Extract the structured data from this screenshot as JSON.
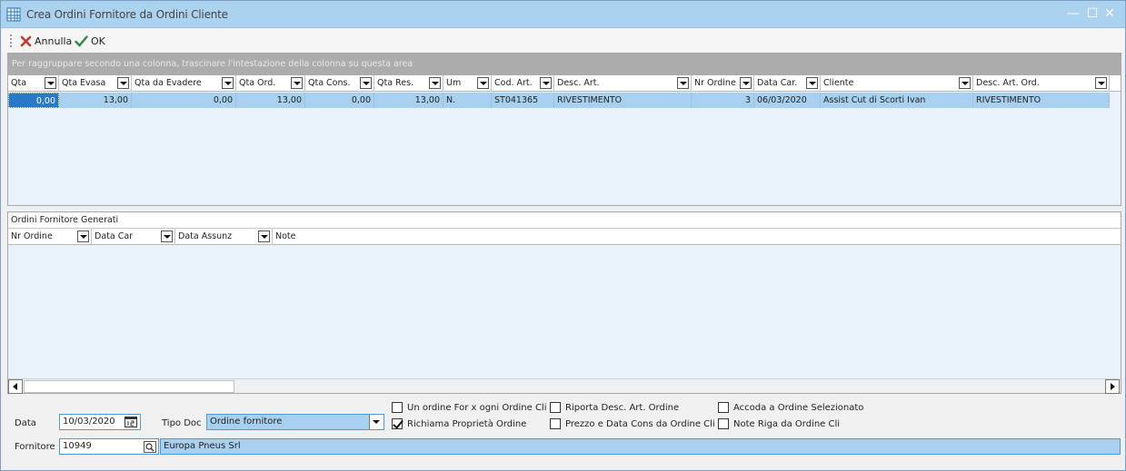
{
  "window": {
    "title": "Crea Ordini Fornitore da Ordini Cliente",
    "controls": {
      "minimize": "—",
      "maximize": "☐",
      "close": "✕"
    }
  },
  "toolbar": {
    "cancel_label": "Annulla",
    "ok_label": "OK"
  },
  "grid1": {
    "group_hint": "Per raggruppare secondo una colonna, trascinare l'intestazione della colonna su questa area",
    "columns": [
      "Qta",
      "Qta Evasa",
      "Qta da Evadere",
      "Qta Ord.",
      "Qta Cons.",
      "Qta Res.",
      "Um",
      "Cod. Art.",
      "Desc. Art.",
      "Nr Ordine",
      "Data Car.",
      "Cliente",
      "Desc. Art. Ord."
    ],
    "rows": [
      [
        "0,00",
        "13,00",
        "0,00",
        "13,00",
        "0,00",
        "13,00",
        "N.",
        "ST041365",
        "RIVESTIMENTO",
        "3",
        "06/03/2020",
        "Assist Cut di Scorti Ivan",
        "RIVESTIMENTO"
      ]
    ]
  },
  "grid2": {
    "title": "Ordini Fornitore Generati",
    "columns": [
      "Nr Ordine",
      "Data Car",
      "Data Assunz",
      "Note"
    ]
  },
  "form": {
    "data_label": "Data",
    "data_value": "10/03/2020",
    "tipodoc_label": "Tipo Doc",
    "tipodoc_value": "Ordine fornitore",
    "fornitore_label": "Fornitore",
    "fornitore_code": "10949",
    "fornitore_name": "Europa Pneus Srl",
    "checkboxes": [
      {
        "label": "Un ordine For x ogni Ordine Cli",
        "checked": false
      },
      {
        "label": "Richiama Proprietà Ordine",
        "checked": true
      },
      {
        "label": "Riporta Desc. Art. Ordine",
        "checked": false
      },
      {
        "label": "Prezzo e Data Cons da Ordine Cli",
        "checked": false
      },
      {
        "label": "Accoda a Ordine Selezionato",
        "checked": false
      },
      {
        "label": "Note Riga da Ordine Cli",
        "checked": false
      }
    ]
  }
}
